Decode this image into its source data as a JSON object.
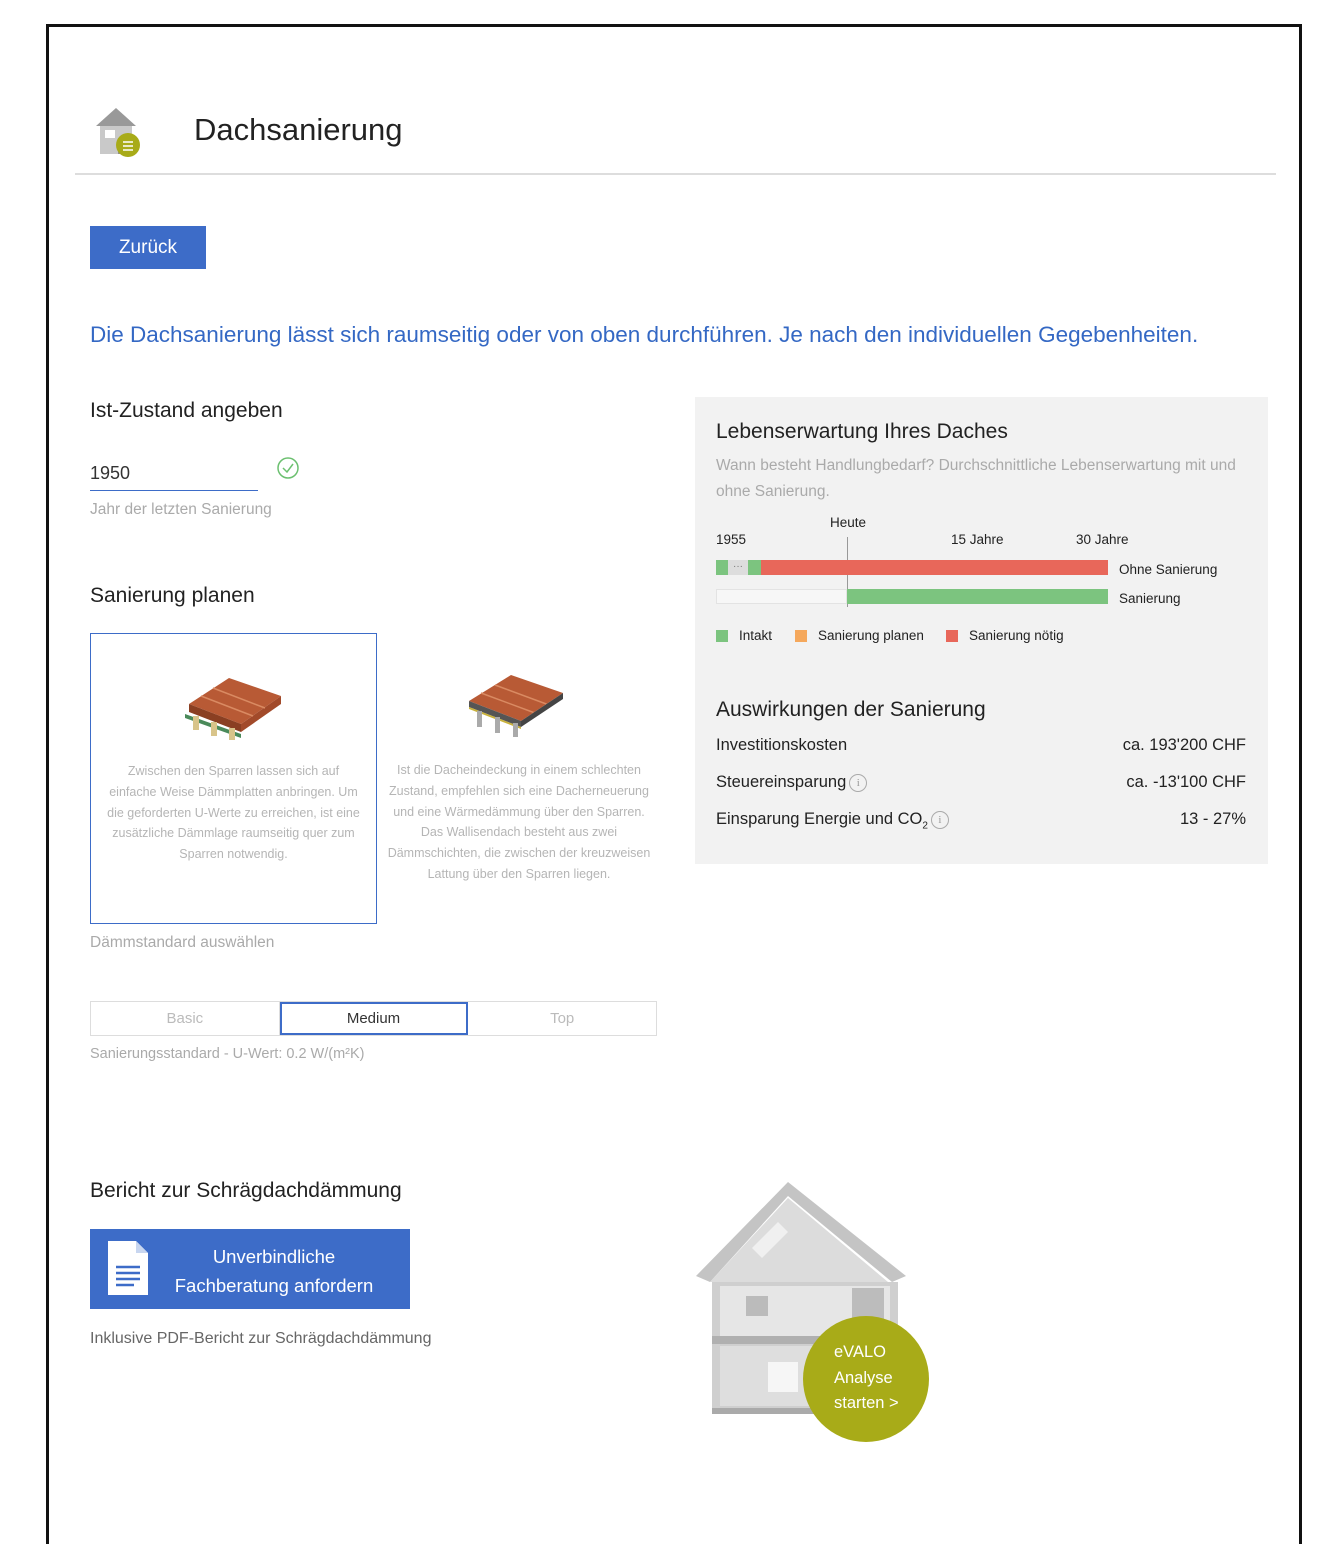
{
  "header": {
    "title": "Dachsanierung",
    "icon": "house-icon"
  },
  "back_button": "Zurück",
  "intro": "Die Dachsanierung lässt sich raumseitig oder von oben durchführen. Je nach den individuellen Gegebenheiten.",
  "ist_zustand": {
    "heading": "Ist-Zustand angeben",
    "year_value": "1950",
    "year_hint": "Jahr der letzten Sanierung"
  },
  "sanierung": {
    "heading": "Sanierung planen",
    "options": [
      {
        "description": "Zwischen den Sparren lassen sich auf einfache Weise Dämmplatten anbringen. Um die geforderten U-Werte zu erreichen, ist eine zusätzliche Dämmlage raumseitig quer zum Sparren notwendig.",
        "selected": true
      },
      {
        "description": "Ist die Dacheindeckung in einem schlechten Zustand, empfehlen sich eine Dacherneuerung und eine Wärmedämmung über den Sparren. Das Wallisendach besteht aus zwei Dämmschichten, die zwischen der kreuzweisen Lattung über den Sparren liegen.",
        "selected": false
      }
    ],
    "standard_hint": "Dämmstandard auswählen",
    "standards": [
      "Basic",
      "Medium",
      "Top"
    ],
    "selected_standard": "Medium",
    "standard_note": "Sanierungsstandard - U-Wert: 0.2 W/(m²K)"
  },
  "lifespan": {
    "heading": "Lebenserwartung Ihres Daches",
    "subtitle": "Wann besteht Handlungbedarf? Durchschnittliche Lebenserwartung mit und ohne Sanierung.",
    "start_label": "1955",
    "today_label": "Heute",
    "mark_15": "15 Jahre",
    "mark_30": "30 Jahre",
    "ellipsis": "···",
    "row1_label": "Ohne Sanierung",
    "row2_label": "Sanierung",
    "legend": [
      {
        "label": "Intakt",
        "color": "#7cc47f"
      },
      {
        "label": "Sanierung planen",
        "color": "#f5a85c"
      },
      {
        "label": "Sanierung nötig",
        "color": "#e8675a"
      }
    ]
  },
  "effects": {
    "heading": "Auswirkungen der Sanierung",
    "rows": [
      {
        "label": "Investitionskosten",
        "value": "ca. 193'200 CHF"
      },
      {
        "label": "Steuereinsparung",
        "value": "ca. -13'100 CHF"
      },
      {
        "label": "Einsparung Energie und CO",
        "sub": "2",
        "value": "13 - 27%"
      }
    ]
  },
  "report": {
    "heading": "Bericht zur Schrägdachdämmung",
    "button_line1": "Unverbindliche",
    "button_line2": "Fachberatung anfordern",
    "note": "Inklusive PDF-Bericht zur Schrägdachdämmung"
  },
  "evalo": {
    "line1": "eVALO",
    "line2": "Analyse",
    "line3": "starten >"
  },
  "colors": {
    "accent": "#3d6cc8",
    "green": "#7cc47f",
    "red": "#e8675a",
    "orange": "#f5a85c",
    "evalo": "#a8ab18"
  }
}
